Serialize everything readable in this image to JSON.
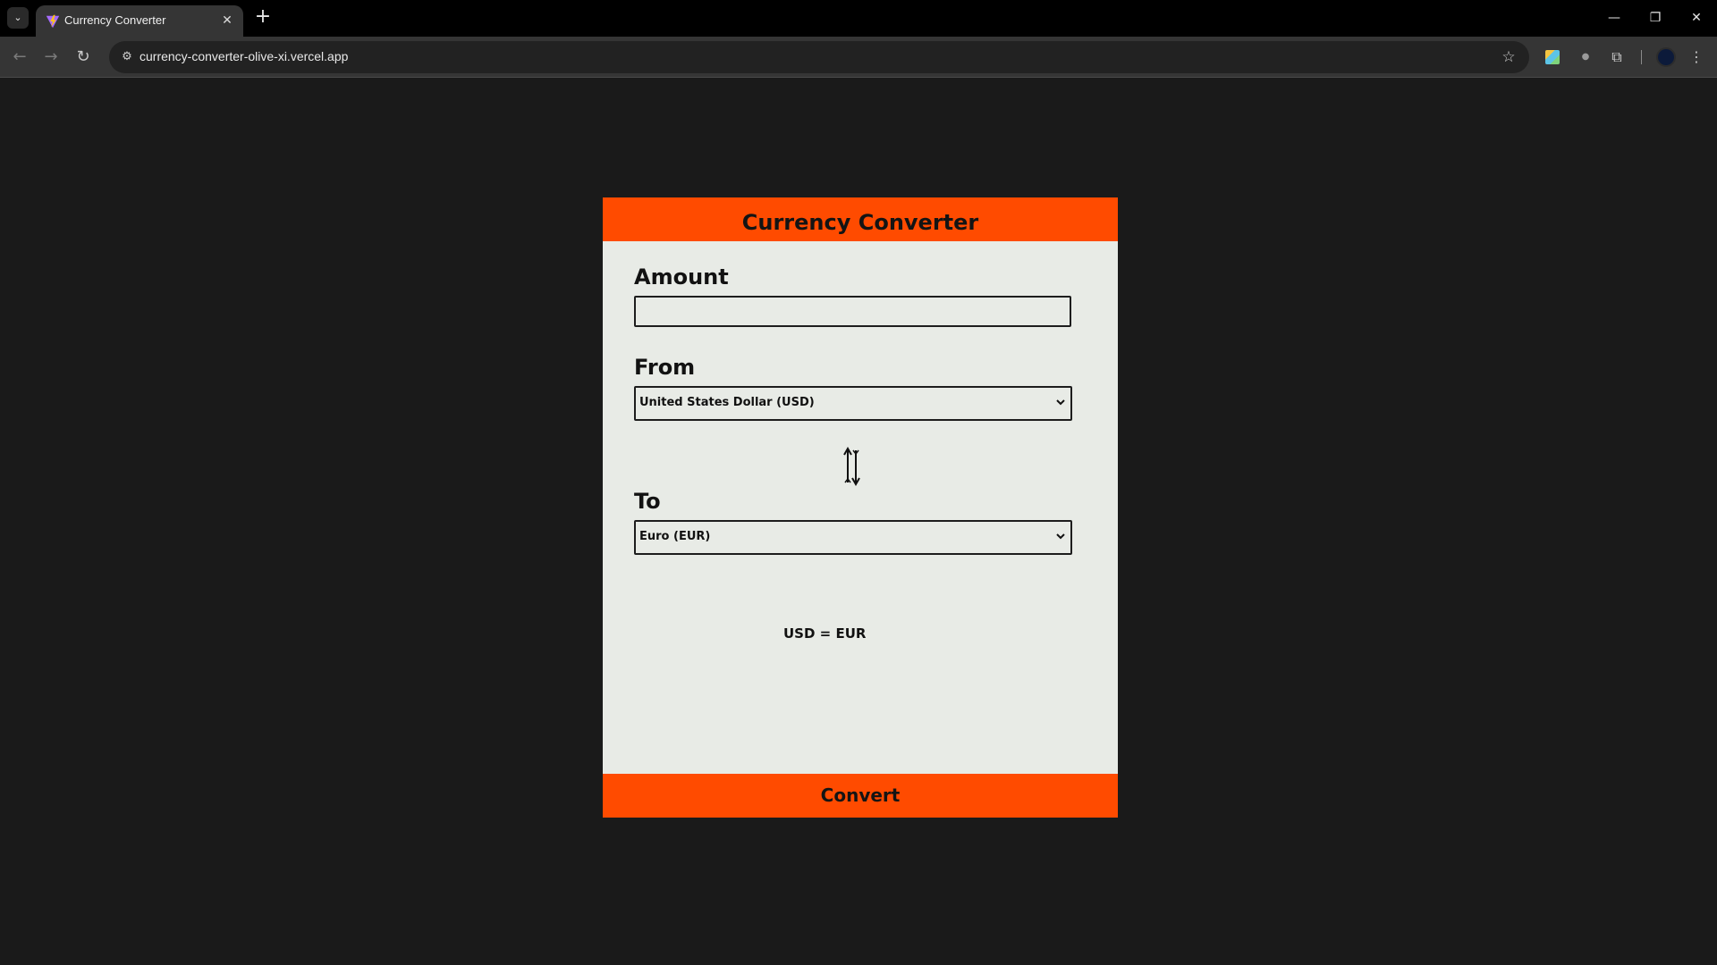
{
  "browser": {
    "tab_title": "Currency Converter",
    "url": "currency-converter-olive-xi.vercel.app",
    "icons": {
      "tab_menu": "chevron-down-icon",
      "tab_close": "close-icon",
      "new_tab": "plus-icon",
      "back": "arrow-left-icon",
      "forward": "arrow-right-icon",
      "reload": "reload-icon",
      "site_info": "tune-icon",
      "bookmark": "star-icon",
      "extensions": "puzzle-icon",
      "menu": "kebab-menu-icon"
    },
    "glyphs": {
      "tab_menu": "⌄",
      "tab_close": "✕",
      "new_tab": "+",
      "back": "←",
      "forward": "→",
      "reload": "↻",
      "site_info": "⚙",
      "star": "☆",
      "ext_dot": "●",
      "puzzle": "⧉",
      "menu": "⋮",
      "minimize": "—",
      "restore": "❐",
      "close": "✕"
    }
  },
  "converter": {
    "title": "Currency Converter",
    "amount_label": "Amount",
    "amount_value": "",
    "from_label": "From",
    "from_selected": "United States Dollar (USD)",
    "to_label": "To",
    "to_selected": "Euro (EUR)",
    "rate_text": "USD = EUR",
    "convert_label": "Convert",
    "colors": {
      "accent": "#ff4b00",
      "card_bg": "#e8ebe6",
      "page_bg": "#1a1a1a",
      "text": "#141414"
    }
  }
}
